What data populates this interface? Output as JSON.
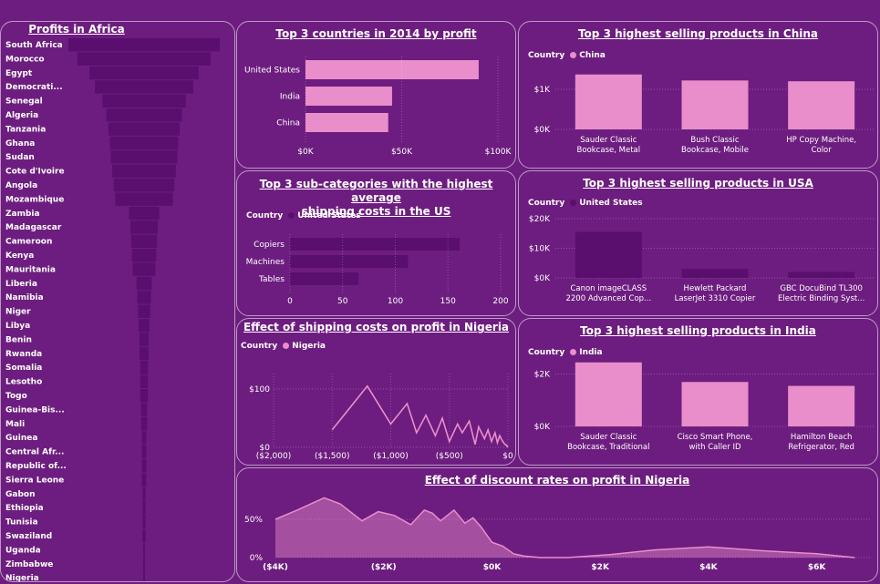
{
  "colors": {
    "light": "#e98ecb",
    "dark": "#5a0e6e",
    "bg": "#6d1d7f"
  },
  "legend_label": "Country",
  "africa": {
    "title": "Profits in Africa",
    "chart_data": {
      "type": "funnel",
      "categories": [
        "South Africa",
        "Morocco",
        "Egypt",
        "Democrati...",
        "Senegal",
        "Algeria",
        "Tanzania",
        "Ghana",
        "Sudan",
        "Cote d'Ivoire",
        "Angola",
        "Mozambique",
        "Zambia",
        "Madagascar",
        "Cameroon",
        "Kenya",
        "Mauritania",
        "Liberia",
        "Namibia",
        "Niger",
        "Libya",
        "Benin",
        "Rwanda",
        "Somalia",
        "Lesotho",
        "Togo",
        "Guinea-Bis...",
        "Mali",
        "Guinea",
        "Central Afr...",
        "Republic of...",
        "Sierra Leone",
        "Gabon",
        "Ethiopia",
        "Tunisia",
        "Swaziland",
        "Uganda",
        "Zimbabwe",
        "Nigeria"
      ],
      "values": [
        100,
        88,
        72,
        65,
        55,
        50,
        47,
        45,
        44,
        42,
        40,
        38,
        20,
        18,
        17,
        16,
        15,
        10,
        9,
        8,
        7,
        6,
        6,
        5,
        5,
        5,
        4,
        4,
        3,
        3,
        3,
        3,
        2,
        2,
        2,
        2,
        1,
        1,
        1
      ]
    }
  },
  "top_countries": {
    "title": "Top 3 countries in 2014 by profit",
    "chart_data": {
      "type": "bar",
      "orientation": "horizontal",
      "categories": [
        "United States",
        "India",
        "China"
      ],
      "values": [
        90000,
        45000,
        43000
      ],
      "xlim": [
        0,
        100000
      ],
      "xticks": [
        "$0K",
        "$50K",
        "$100K"
      ]
    }
  },
  "china": {
    "title": "Top 3 highest selling products in China",
    "legend_value": "China",
    "chart_data": {
      "type": "bar",
      "categories": [
        [
          "Sauder Classic",
          "Bookcase, Metal"
        ],
        [
          "Bush Classic",
          "Bookcase, Mobile"
        ],
        [
          "HP Copy Machine,",
          "Color"
        ]
      ],
      "values": [
        1370,
        1220,
        1200
      ],
      "ylim": [
        0,
        2000
      ],
      "yticks": [
        [
          "$1K",
          1000
        ],
        [
          "$0K",
          0
        ]
      ]
    }
  },
  "shipping_us": {
    "title_lines": [
      "Top 3 sub-categories with the highest average",
      "shipping costs in the US"
    ],
    "legend_value": "United States",
    "chart_data": {
      "type": "bar",
      "orientation": "horizontal",
      "categories": [
        "Copiers",
        "Machines",
        "Tables"
      ],
      "values": [
        161,
        112,
        65
      ],
      "xlim": [
        0,
        200
      ],
      "xticks": [
        "0",
        "50",
        "100",
        "150",
        "200"
      ]
    }
  },
  "usa": {
    "title": "Top 3 highest selling products in USA",
    "legend_value": "United States",
    "chart_data": {
      "type": "bar",
      "categories": [
        [
          "Canon imageCLASS",
          "2200 Advanced Cop..."
        ],
        [
          "Hewlett Packard",
          "LaserJet 3310 Copier"
        ],
        [
          "GBC DocuBind TL300",
          "Electric Binding Syst..."
        ]
      ],
      "values": [
        15500,
        3000,
        2000
      ],
      "ylim": [
        0,
        20000
      ],
      "yticks": [
        [
          "$20K",
          20000
        ],
        [
          "$10K",
          10000
        ],
        [
          "$0K",
          0
        ]
      ]
    }
  },
  "ship_nigeria": {
    "title": "Effect of shipping costs on profit in Nigeria",
    "legend_value": "Nigeria",
    "chart_data": {
      "type": "line",
      "x": [
        -1500,
        -1200,
        -1000,
        -860,
        -780,
        -700,
        -620,
        -560,
        -500,
        -430,
        -390,
        -330,
        -280,
        -250,
        -200,
        -170,
        -140,
        -110,
        -90,
        -70,
        -50,
        -30,
        -10,
        0
      ],
      "y": [
        30,
        105,
        40,
        75,
        25,
        55,
        20,
        50,
        10,
        40,
        25,
        45,
        5,
        35,
        15,
        30,
        10,
        25,
        8,
        20,
        12,
        6,
        3,
        0
      ],
      "xlim": [
        -2000,
        0
      ],
      "ylim": [
        0,
        130
      ],
      "xticks": [
        "($2,000)",
        "($1,500)",
        "($1,000)",
        "($500)",
        "$0"
      ],
      "yticks": [
        "$100",
        "$0"
      ]
    }
  },
  "india": {
    "title": "Top 3 highest selling products in India",
    "legend_value": "India",
    "chart_data": {
      "type": "bar",
      "categories": [
        [
          "Sauder Classic",
          "Bookcase, Traditional"
        ],
        [
          "Cisco Smart Phone,",
          "with Caller ID"
        ],
        [
          "Hamilton Beach",
          "Refrigerator, Red"
        ]
      ],
      "values": [
        2450,
        1700,
        1550
      ],
      "ylim": [
        0,
        3000
      ],
      "yticks": [
        [
          "$2K",
          2000
        ],
        [
          "$0K",
          0
        ]
      ]
    }
  },
  "discount": {
    "title": "Effect of discount rates on profit in Nigeria",
    "chart_data": {
      "type": "area",
      "x": [
        -4000,
        -3600,
        -3100,
        -2800,
        -2400,
        -2100,
        -1800,
        -1500,
        -1250,
        -1100,
        -950,
        -700,
        -500,
        -350,
        -200,
        -100,
        0,
        200,
        400,
        600,
        900,
        1400,
        2200,
        3000,
        4000,
        5000,
        6000,
        6700
      ],
      "y": [
        0.5,
        0.62,
        0.78,
        0.7,
        0.48,
        0.6,
        0.55,
        0.43,
        0.62,
        0.58,
        0.48,
        0.62,
        0.45,
        0.52,
        0.4,
        0.3,
        0.2,
        0.15,
        0.05,
        0.02,
        0,
        0,
        0.04,
        0.1,
        0.14,
        0.09,
        0.05,
        0
      ],
      "xlim": [
        -4000,
        7000
      ],
      "ylim": [
        0,
        1
      ],
      "xticks": [
        "($4K)",
        "($2K)",
        "$0K",
        "$2K",
        "$4K",
        "$6K"
      ],
      "yticks": [
        "50%",
        "0%"
      ]
    }
  }
}
